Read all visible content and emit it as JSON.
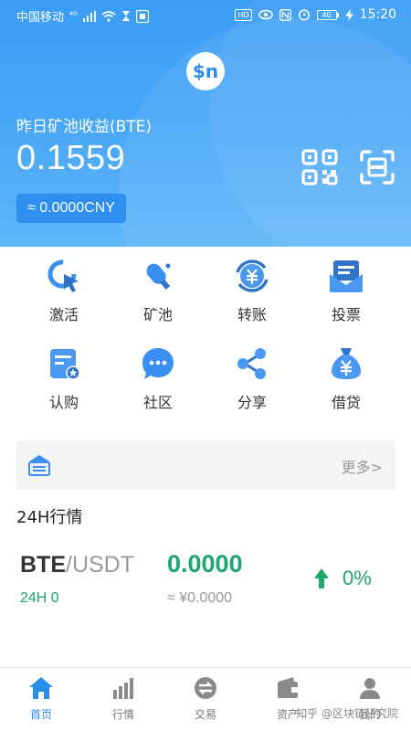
{
  "status_bar": {
    "carrier": "中国移动",
    "signal": "⁴ᴳ",
    "time": "15:20",
    "hd": "HD",
    "battery": "40"
  },
  "header": {
    "logo_text": "$n",
    "earnings_label": "昨日矿池收益(BTE)",
    "earnings_value": "0.1559",
    "cny_value": "≈ 0.0000CNY"
  },
  "menu": [
    {
      "label": "激活",
      "icon": "activate-icon"
    },
    {
      "label": "矿池",
      "icon": "mining-pool-icon"
    },
    {
      "label": "转账",
      "icon": "transfer-icon"
    },
    {
      "label": "投票",
      "icon": "vote-icon"
    },
    {
      "label": "认购",
      "icon": "subscribe-icon"
    },
    {
      "label": "社区",
      "icon": "community-icon"
    },
    {
      "label": "分享",
      "icon": "share-icon"
    },
    {
      "label": "借贷",
      "icon": "loan-icon"
    }
  ],
  "notice": {
    "more_label": "更多>"
  },
  "market_section": {
    "title": "24H行情"
  },
  "market": {
    "base": "BTE",
    "quote": "/USDT",
    "h24": "24H 0",
    "price": "0.0000",
    "price_cny": "≈ ¥0.0000",
    "change": "0%"
  },
  "bottom_nav": [
    {
      "label": "首页",
      "icon": "home-icon",
      "active": true
    },
    {
      "label": "行情",
      "icon": "market-icon",
      "active": false
    },
    {
      "label": "交易",
      "icon": "trade-icon",
      "active": false
    },
    {
      "label": "资产",
      "icon": "wallet-icon",
      "active": false
    },
    {
      "label": "我的",
      "icon": "profile-icon",
      "active": false
    }
  ],
  "watermark": "知乎 @区块链研究院",
  "colors": {
    "primary": "#3b9df5",
    "accent": "#2a8de9",
    "green": "#1fa56e"
  }
}
